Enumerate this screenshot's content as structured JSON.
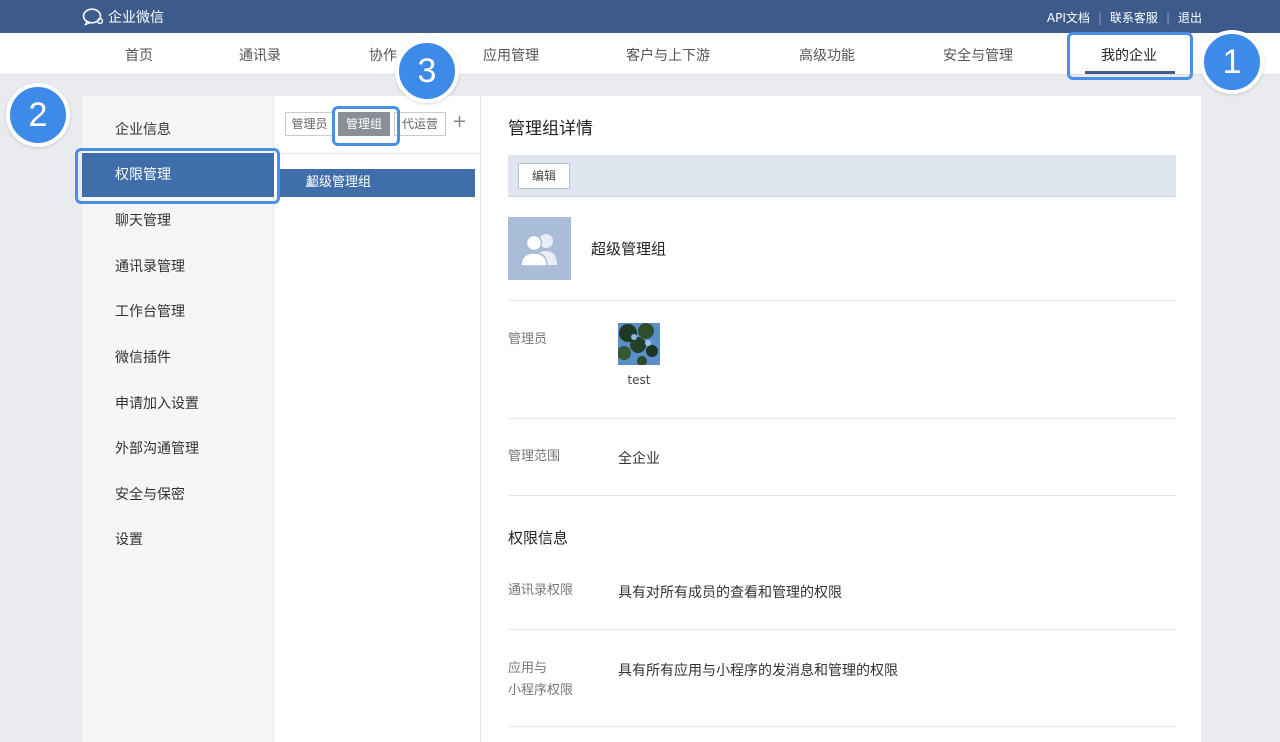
{
  "app": {
    "title": "企业微信"
  },
  "top_links": [
    "API文档",
    "联系客服",
    "退出"
  ],
  "nav": {
    "items": [
      "首页",
      "通讯录",
      "协作",
      "应用管理",
      "客户与上下游",
      "高级功能",
      "安全与管理",
      "我的企业"
    ],
    "active": "我的企业"
  },
  "badges": [
    "1",
    "2",
    "3"
  ],
  "sidebar": {
    "items": [
      "企业信息",
      "权限管理",
      "聊天管理",
      "通讯录管理",
      "工作台管理",
      "微信插件",
      "申请加入设置",
      "外部沟通管理",
      "安全与保密",
      "设置"
    ],
    "active": "权限管理"
  },
  "tabs": {
    "items": [
      "管理员",
      "管理组",
      "代运营"
    ],
    "active": "管理组",
    "add": "+"
  },
  "group_list": [
    "超级管理组"
  ],
  "detail": {
    "title": "管理组详情",
    "edit_label": "编辑",
    "group_name": "超级管理组",
    "admin_label": "管理员",
    "admin_name": "test",
    "scope_label": "管理范围",
    "scope_value": "全企业",
    "permissions_title": "权限信息",
    "contacts_perm_label": "通讯录权限",
    "contacts_perm_value": "具有对所有成员的查看和管理的权限",
    "apps_perm_label_1": "应用与",
    "apps_perm_label_2": "小程序权限",
    "apps_perm_value": "具有所有应用与小程序的发消息和管理的权限"
  },
  "colors": {
    "topbar": "#3c5a8a",
    "accent": "#3f6eab",
    "highlight": "#4a8fe7",
    "badge": "#3d8ae8"
  }
}
